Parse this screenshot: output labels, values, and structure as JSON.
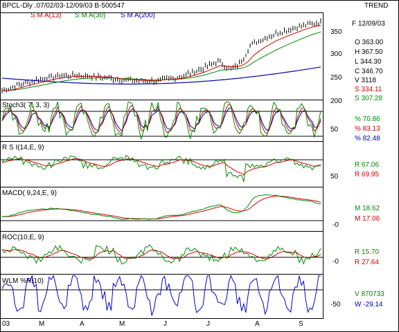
{
  "header": {
    "title": "BPCL-Dly .07/02/03-12/09/03  B-500547",
    "trend_label": "TREND"
  },
  "colors": {
    "price": "#000000",
    "sma13": "#cc0000",
    "sma30": "#008800",
    "sma200": "#0000aa",
    "stoch_k": "#008800",
    "stoch_d": "#cc0000",
    "stoch_slow": "#0000aa",
    "rsi": "#008800",
    "rsi_avg": "#cc0000",
    "macd": "#008800",
    "macd_signal": "#cc0000",
    "roc": "#008800",
    "roc_avg": "#cc0000",
    "wlm": "#0000cc",
    "grid": "#000000"
  },
  "chart_data": [
    {
      "type": "line",
      "panel": "price",
      "series": [
        {
          "name": "S M A(13)",
          "values": []
        },
        {
          "name": "S M A(30)",
          "values": []
        },
        {
          "name": "S M A(200)",
          "values": []
        }
      ],
      "yticks": [
        "350",
        "300",
        "250",
        "200"
      ],
      "ylim": [
        200,
        372
      ],
      "info": [
        {
          "label": "F 12/09/03",
          "color": "#000000"
        },
        {
          "label": "O   363.00",
          "color": "#000000"
        },
        {
          "label": "H   367.50",
          "color": "#000000"
        },
        {
          "label": "L   344.30",
          "color": "#000000"
        },
        {
          "label": "C   346.70",
          "color": "#000000"
        },
        {
          "label": "V      3118",
          "color": "#000000"
        },
        {
          "label": "S   334.11",
          "color": "#cc0000"
        },
        {
          "label": "S   307.28",
          "color": "#008800"
        }
      ]
    },
    {
      "type": "line",
      "panel": "stoch",
      "title": "Stoch3( 7, 3, 3)",
      "yticks": [
        "50"
      ],
      "info": [
        {
          "label": "%    70.86",
          "color": "#008800"
        },
        {
          "label": "%    83.13",
          "color": "#cc0000"
        },
        {
          "label": "%    82.48",
          "color": "#0000aa"
        }
      ]
    },
    {
      "type": "line",
      "panel": "rsi",
      "title": "R S I(14,E, 9)",
      "yticks": [
        "50"
      ],
      "info": [
        {
          "label": "R    67.06",
          "color": "#008800"
        },
        {
          "label": "R    69.95",
          "color": "#cc0000"
        }
      ]
    },
    {
      "type": "line",
      "panel": "macd",
      "title": "MACD( 9,24,E, 9)",
      "yticks": [
        "-0"
      ],
      "info": [
        {
          "label": "M    18.62",
          "color": "#008800"
        },
        {
          "label": "M    17.06",
          "color": "#cc0000"
        }
      ]
    },
    {
      "type": "line",
      "panel": "roc",
      "title": "ROC(10,E, 9)",
      "yticks": [
        "-0"
      ],
      "info": [
        {
          "label": "R    15.70",
          "color": "#008800"
        },
        {
          "label": "R    27.64",
          "color": "#cc0000"
        }
      ]
    },
    {
      "type": "line",
      "panel": "wlm",
      "title": "WLM %R(10)",
      "yticks": [
        "-50"
      ],
      "info": [
        {
          "label": "V  870733",
          "color": "#008800"
        },
        {
          "label": "W   -29.14",
          "color": "#0000aa"
        }
      ]
    }
  ],
  "x_axis": {
    "labels": [
      "03",
      "M",
      "A",
      "M",
      "J",
      "J",
      "A",
      "S"
    ]
  }
}
